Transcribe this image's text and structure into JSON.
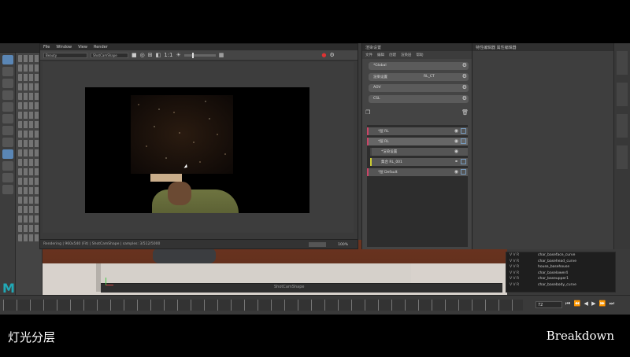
{
  "render_view": {
    "menu": [
      "File",
      "Window",
      "View",
      "Render"
    ],
    "camera_select": "Beauty",
    "shape_select": "ShotCamShape",
    "ratio": "1:1",
    "status_text": "Rendering | 960x540 (Fit) | ShotCamShape | samples: 3/512/5000",
    "zoom": "100%"
  },
  "render_setup": {
    "title": "渲染设置",
    "tabs": [
      "文件",
      "编辑",
      "创建",
      "渲染层",
      "帮助"
    ],
    "rows": [
      {
        "label": "*Global",
        "value": ""
      },
      {
        "label": "渲染设置",
        "value": "RL_CT"
      },
      {
        "label": "AOV",
        "value": ""
      },
      {
        "label": "CSL",
        "value": ""
      }
    ],
    "layers": [
      {
        "label": "*层 RL",
        "value": ""
      },
      {
        "label": "*层 RL",
        "value": ""
      },
      {
        "label": "*渲染设置",
        "value": ""
      },
      {
        "label": "集合 RL_001",
        "value": ""
      },
      {
        "label": "*层 Default",
        "value": ""
      }
    ]
  },
  "right_panel": {
    "title": "特性编辑器 属性编辑器"
  },
  "outliner": {
    "rows": [
      {
        "flags": "V V R",
        "name": "char_baseface_curve"
      },
      {
        "flags": "V V R",
        "name": "char_basehead_curve"
      },
      {
        "flags": "V V R",
        "name": "house_basehouse"
      },
      {
        "flags": "V V R",
        "name": "char_baselower4"
      },
      {
        "flags": "V V R",
        "name": "char_baseupper1"
      },
      {
        "flags": "V V R",
        "name": "char_basebody_curve"
      }
    ]
  },
  "timeline": {
    "current_frame": "72",
    "controls": "⏮ ⏪ ◀ ▶ ⏩ ⏭"
  },
  "viewport": {
    "caption": "ShotCamShape"
  },
  "subtitles": {
    "left": "灯光分层",
    "right": "Breakdown"
  },
  "colors": {
    "accent": "#5a86b5",
    "maya_logo": "#21a8b5",
    "layer_marker": "#cc4466"
  }
}
